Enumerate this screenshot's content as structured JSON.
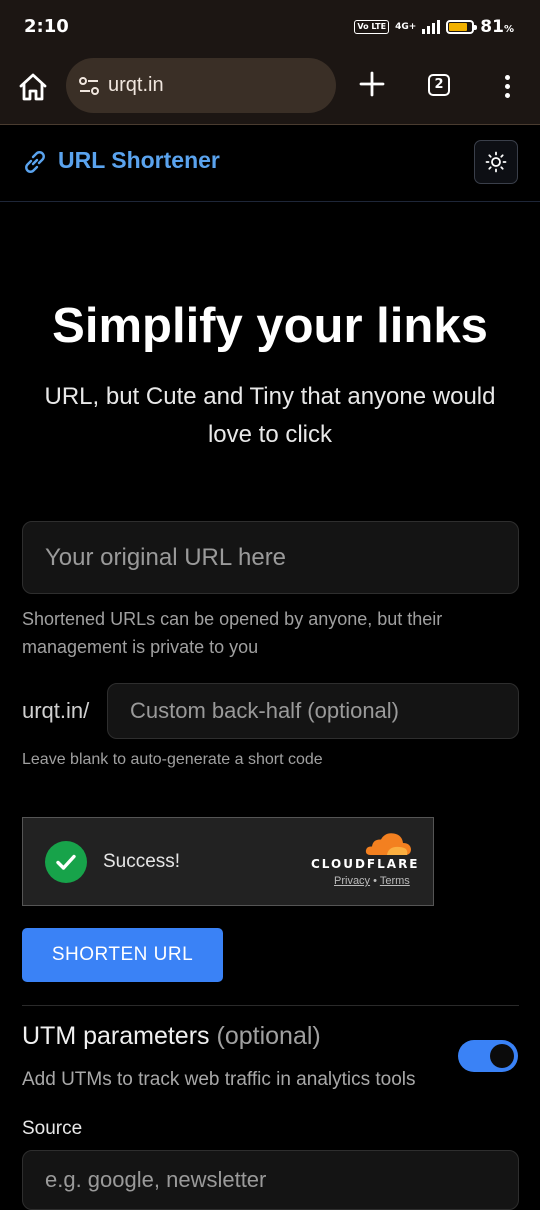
{
  "status_bar": {
    "time": "2:10",
    "volte": "Vo LTE",
    "network": "4G+",
    "battery_percent": "81",
    "battery_unit": "%",
    "battery_level": 0.81,
    "battery_color": "#f2b100"
  },
  "browser": {
    "url": "urqt.in",
    "tab_count": "2",
    "icons": [
      "home-icon",
      "site-settings-icon",
      "new-tab-icon",
      "tab-switcher-icon",
      "more-menu-icon"
    ]
  },
  "header": {
    "brand": "URL Shortener",
    "brand_color": "#5aa3ee",
    "logo_icon": "link-icon",
    "theme_icon": "sun-icon"
  },
  "hero": {
    "title": "Simplify your links",
    "subtitle": "URL, but Cute and Tiny that anyone would love to click"
  },
  "form": {
    "url_placeholder": "Your original URL here",
    "url_value": "",
    "url_help": "Shortened URLs can be opened by anyone, but their management is private to you",
    "prefix": "urqt.in/",
    "backhalf_placeholder": "Custom back-half (optional)",
    "backhalf_value": "",
    "backhalf_help": "Leave blank to auto-generate a short code",
    "submit_label": "SHORTEN URL",
    "accent_color": "#3a82f6"
  },
  "captcha": {
    "status": "Success!",
    "provider": "CLOUDFLARE",
    "privacy": "Privacy",
    "separator": "•",
    "terms": "Terms"
  },
  "utm": {
    "title": "UTM parameters",
    "optional": "(optional)",
    "description": "Add UTMs to track web traffic in analytics tools",
    "enabled": true,
    "source_label": "Source",
    "source_placeholder": "e.g. google, newsletter",
    "source_value": ""
  }
}
